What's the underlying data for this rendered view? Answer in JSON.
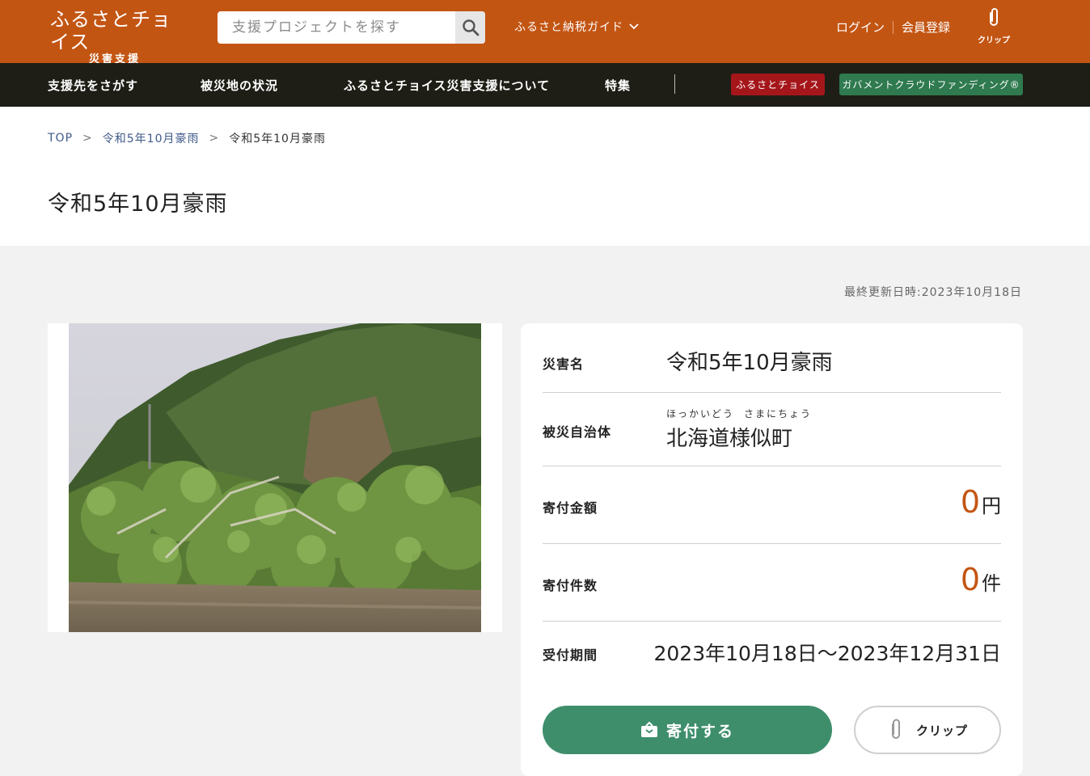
{
  "header": {
    "logo_main": "ふるさとチョイス",
    "logo_sub": "災害支援",
    "search_placeholder": "支援プロジェクトを探す",
    "guide_label": "ふるさと納税ガイド",
    "login_label": "ログイン",
    "register_label": "会員登録",
    "clip_label": "クリップ",
    "brand_color": "#c35513"
  },
  "nav": {
    "items": [
      "支援先をさがす",
      "被災地の状況",
      "ふるさとチョイス災害支援について",
      "特集"
    ],
    "badge_choice": "ふるさとチョイス",
    "badge_gcf": "ガバメントクラウドファンディング®",
    "badge_choice_color": "#a5161b",
    "badge_gcf_color": "#2f7a4f"
  },
  "breadcrumb": {
    "top": "TOP",
    "parent": "令和5年10月豪雨",
    "current": "令和5年10月豪雨",
    "sep": ">"
  },
  "page": {
    "title": "令和5年10月豪雨",
    "updated": "最終更新日時:2023年10月18日"
  },
  "info": {
    "disaster_label": "災害名",
    "disaster_value": "令和5年10月豪雨",
    "municipality_label": "被災自治体",
    "municipality_ruby_1": "ほっかいどう",
    "municipality_ruby_2": "さまにちょう",
    "municipality_value": "北海道様似町",
    "amount_label": "寄付金額",
    "amount_value": "0",
    "amount_unit": "円",
    "count_label": "寄付件数",
    "count_value": "0",
    "count_unit": "件",
    "period_label": "受付期間",
    "period_value": "2023年10月18日〜2023年12月31日"
  },
  "actions": {
    "donate_label": "寄付する",
    "clip_label": "クリップ",
    "donate_color": "#3e8e6c"
  }
}
